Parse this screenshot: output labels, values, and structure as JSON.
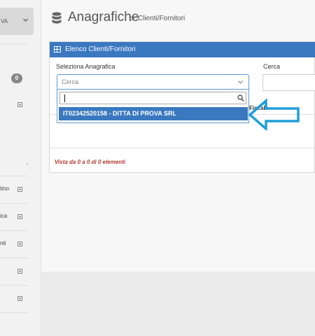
{
  "sidebar": {
    "company_label": "VA",
    "badge": "0",
    "items": [
      {
        "label": "tino"
      },
      {
        "label": "ica"
      },
      {
        "label": "nti"
      },
      {
        "label": ""
      },
      {
        "label": ""
      }
    ]
  },
  "header": {
    "title": "Anagrafiche",
    "separator": ">",
    "breadcrumb": "Clienti/Fornitori"
  },
  "panel": {
    "title": "Elenco Clienti/Fornitori",
    "select_label": "Seleziona Anagrafica",
    "select_placeholder": "Cerca",
    "search_label": "Cerca",
    "dropdown": {
      "option_code": "IT02342520158",
      "option_text": " - DITTA DI PROVA SRL"
    },
    "column_header": "Fiscale",
    "info_text": "Vista da 0 a 0 di 0 elementi"
  },
  "colors": {
    "accent": "#3a78c0",
    "arrow": "#1e9fd8",
    "info_text": "#b03a2e"
  }
}
